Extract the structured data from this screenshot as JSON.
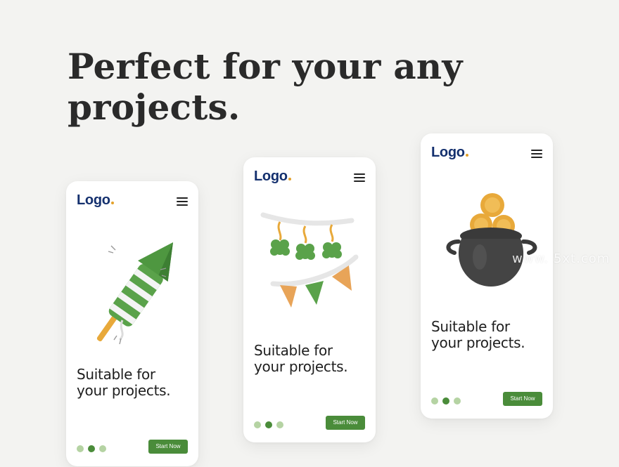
{
  "headline": {
    "line1": "Perfect for your any",
    "line2": "projects."
  },
  "colors": {
    "background": "#f3f3f1",
    "logo": "#14306e",
    "logo_dot": "#e3a12a",
    "accent": "#4a8c3a",
    "dot_inactive": "#b5d3a3",
    "dot_active": "#4a8c3a"
  },
  "cards": [
    {
      "logo": "Logo",
      "illustration": "firework-rocket-icon",
      "tagline": [
        "Suitable for",
        "your projects."
      ],
      "button": "Start Now",
      "active_slide": 2,
      "slides_count": 3
    },
    {
      "logo": "Logo",
      "illustration": "clover-bunting-icon",
      "tagline": [
        "Suitable for",
        "your projects."
      ],
      "button": "Start Now",
      "active_slide": 2,
      "slides_count": 3
    },
    {
      "logo": "Logo",
      "illustration": "pot-of-gold-icon",
      "tagline": [
        "Suitable for",
        "your projects."
      ],
      "button": "Start Now",
      "active_slide": 2,
      "slides_count": 3
    }
  ],
  "watermark": "www.      5xt.com"
}
